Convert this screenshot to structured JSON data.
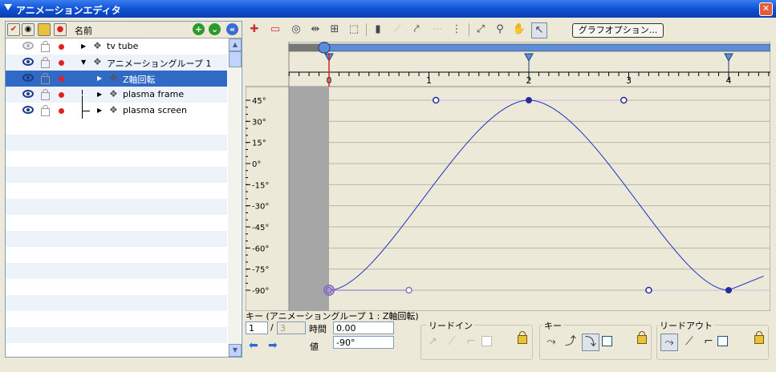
{
  "window": {
    "title": "アニメーションエディタ",
    "close": "✕"
  },
  "list": {
    "header_name": "名前",
    "rows": [
      {
        "label": "tv tube",
        "indent": 0,
        "expander": "▶",
        "dim_eye": true,
        "selected": false
      },
      {
        "label": "アニメーショングループ 1",
        "indent": 0,
        "expander": "▼",
        "dim_eye": false,
        "selected": false
      },
      {
        "label": "Z軸回転",
        "indent": 1,
        "expander": "▶",
        "dim_eye": false,
        "selected": true
      },
      {
        "label": "plasma frame",
        "indent": 1,
        "expander": "▶",
        "dim_eye": false,
        "selected": false
      },
      {
        "label": "plasma screen",
        "indent": 1,
        "expander": "▶",
        "dim_eye": false,
        "selected": false
      }
    ]
  },
  "toolbar": {
    "graph_options": "グラフオプション...",
    "icons": [
      "add-key-icon",
      "delete-key-icon",
      "eye-icon",
      "fit-width-icon",
      "fit-all-icon",
      "select-key-icon",
      "trash-icon",
      "link-icon",
      "node-icon",
      "dotted-icon",
      "info-icon",
      "add-curve-icon",
      "zoom-icon",
      "hand-icon",
      "pointer-icon"
    ]
  },
  "chart_data": {
    "type": "line",
    "x_ticks": [
      "0",
      "1",
      "2",
      "3",
      "4"
    ],
    "y_ticks": [
      "45°",
      "30°",
      "15°",
      "0°",
      "-15°",
      "-30°",
      "-45°",
      "-60°",
      "-75°",
      "-90°"
    ],
    "ylim": [
      -90,
      45
    ],
    "xlim": [
      0,
      4
    ],
    "keys": [
      {
        "t": 0,
        "v": -90,
        "in": [
          -1.0,
          -90
        ],
        "out": [
          0.8,
          -90
        ],
        "selected": true
      },
      {
        "t": 2,
        "v": 45,
        "in": [
          1.07,
          45
        ],
        "out": [
          2.95,
          45
        ],
        "selected": false
      },
      {
        "t": 4,
        "v": -90,
        "in": [
          3.2,
          -90
        ],
        "out": [
          5.0,
          -90
        ],
        "selected": false
      }
    ],
    "markers": [
      0,
      2,
      4
    ],
    "playhead": 0
  },
  "key_panel": {
    "title": "キー (アニメーショングループ 1 : Z軸回転)",
    "index": "1",
    "slash": "/",
    "total": "3",
    "time_label": "時間",
    "time_value": "0.00",
    "value_label": "値",
    "value_value": "-90°",
    "lead_in": "リードイン",
    "key": "キー",
    "lead_out": "リードアウト"
  }
}
